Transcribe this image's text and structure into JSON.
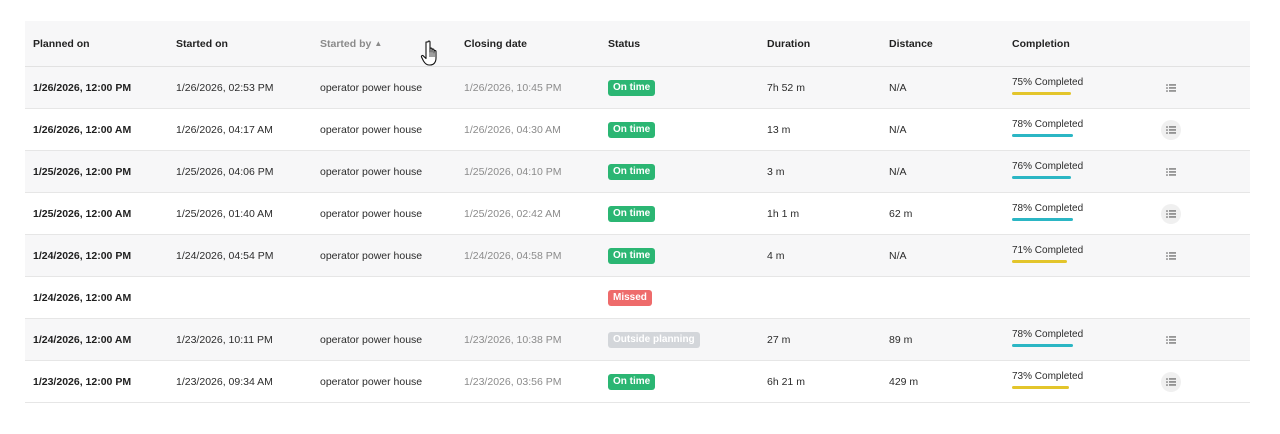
{
  "table": {
    "columns": [
      "Planned on",
      "Started on",
      "Started by",
      "Closing date",
      "Status",
      "Duration",
      "Distance",
      "Completion"
    ],
    "sort_indicator": "▲",
    "rows": [
      {
        "planned": "1/26/2026, 12:00 PM",
        "started": "1/26/2026, 02:53 PM",
        "started_by": "operator power house",
        "closing": "1/26/2026, 10:45 PM",
        "status": "On time",
        "status_color": "#2bb673",
        "duration": "7h 52 m",
        "distance": "N/A",
        "completion": "75% Completed",
        "completion_pct": 75,
        "bar_color": "#e3c52b",
        "action_icon": "list-icon"
      },
      {
        "planned": "1/26/2026, 12:00 AM",
        "started": "1/26/2026, 04:17 AM",
        "started_by": "operator power house",
        "closing": "1/26/2026, 04:30 AM",
        "status": "On time",
        "status_color": "#2bb673",
        "duration": "13 m",
        "distance": "N/A",
        "completion": "78% Completed",
        "completion_pct": 78,
        "bar_color": "#2bb6c4",
        "action_icon": "list-icon"
      },
      {
        "planned": "1/25/2026, 12:00 PM",
        "started": "1/25/2026, 04:06 PM",
        "started_by": "operator power house",
        "closing": "1/25/2026, 04:10 PM",
        "status": "On time",
        "status_color": "#2bb673",
        "duration": "3 m",
        "distance": "N/A",
        "completion": "76% Completed",
        "completion_pct": 76,
        "bar_color": "#2bb6c4",
        "action_icon": "list-icon"
      },
      {
        "planned": "1/25/2026, 12:00 AM",
        "started": "1/25/2026, 01:40 AM",
        "started_by": "operator power house",
        "closing": "1/25/2026, 02:42 AM",
        "status": "On time",
        "status_color": "#2bb673",
        "duration": "1h 1 m",
        "distance": "62 m",
        "completion": "78% Completed",
        "completion_pct": 78,
        "bar_color": "#2bb6c4",
        "action_icon": "list-icon"
      },
      {
        "planned": "1/24/2026, 12:00 PM",
        "started": "1/24/2026, 04:54 PM",
        "started_by": "operator power house",
        "closing": "1/24/2026, 04:58 PM",
        "status": "On time",
        "status_color": "#2bb673",
        "duration": "4 m",
        "distance": "N/A",
        "completion": "71% Completed",
        "completion_pct": 71,
        "bar_color": "#e3c52b",
        "action_icon": "list-icon"
      },
      {
        "planned": "1/24/2026, 12:00 AM",
        "started": "",
        "started_by": "",
        "closing": "",
        "status": "Missed",
        "status_color": "#ee6b6b",
        "duration": "",
        "distance": "",
        "completion": "",
        "completion_pct": 0,
        "bar_color": "",
        "action_icon": ""
      },
      {
        "planned": "1/24/2026, 12:00 AM",
        "started": "1/23/2026, 10:11 PM",
        "started_by": "operator power house",
        "closing": "1/23/2026, 10:38 PM",
        "status": "Outside planning",
        "status_color": "#d3d6da",
        "duration": "27 m",
        "distance": "89 m",
        "completion": "78% Completed",
        "completion_pct": 78,
        "bar_color": "#2bb6c4",
        "action_icon": "list-icon"
      },
      {
        "planned": "1/23/2026, 12:00 PM",
        "started": "1/23/2026, 09:34 AM",
        "started_by": "operator power house",
        "closing": "1/23/2026, 03:56 PM",
        "status": "On time",
        "status_color": "#2bb673",
        "duration": "6h 21 m",
        "distance": "429 m",
        "completion": "73% Completed",
        "completion_pct": 73,
        "bar_color": "#e3c52b",
        "action_icon": "list-icon"
      }
    ]
  },
  "cursor": {
    "icon": "hand-pointer-icon"
  }
}
